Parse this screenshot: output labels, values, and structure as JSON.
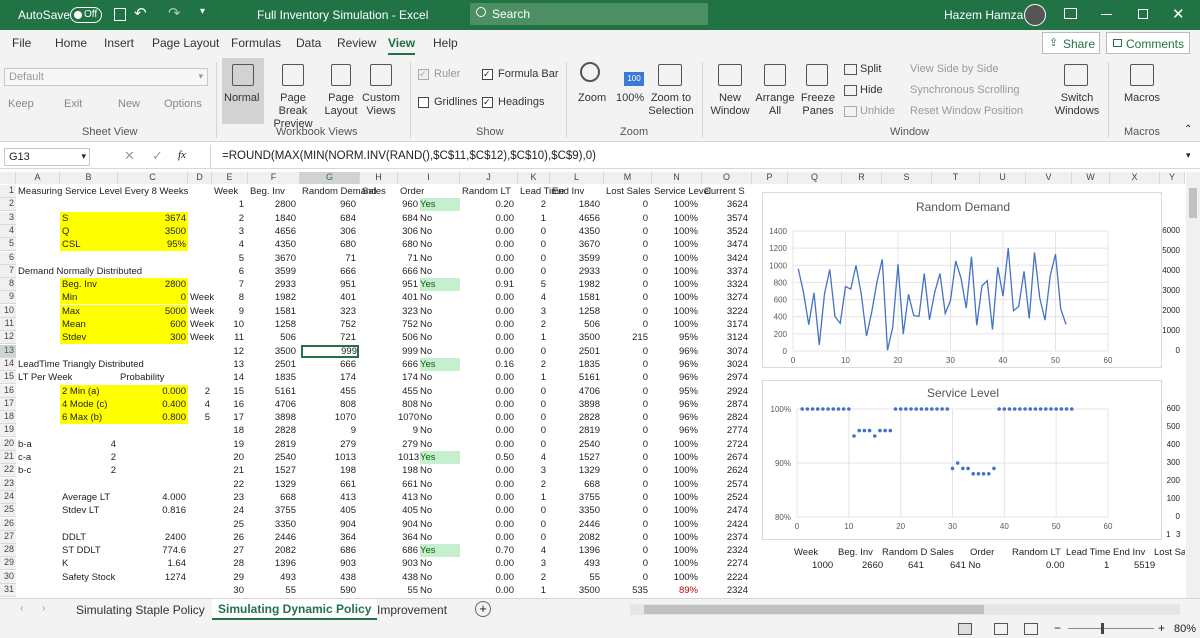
{
  "titlebar": {
    "autosave": "AutoSave",
    "off": "Off",
    "title": "Full Inventory Simulation  -  Excel",
    "search": "Search",
    "user": "Hazem Hamza"
  },
  "menu": [
    "File",
    "Home",
    "Insert",
    "Page Layout",
    "Formulas",
    "Data",
    "Review",
    "View",
    "Help"
  ],
  "share": "Share",
  "comments": "Comments",
  "ribbon": {
    "sheetview_default": "Default",
    "keep": "Keep",
    "exit": "Exit",
    "new": "New",
    "options": "Options",
    "sheet_view": "Sheet View",
    "normal": "Normal",
    "page_break": "Page Break Preview",
    "page_layout": "Page Layout",
    "custom_views": "Custom Views",
    "workbook_views": "Workbook Views",
    "ruler": "Ruler",
    "formula_bar": "Formula Bar",
    "gridlines": "Gridlines",
    "headings": "Headings",
    "show": "Show",
    "zoom": "Zoom",
    "zoom100": "100%",
    "zoom_sel": "Zoom to Selection",
    "zoom_group": "Zoom",
    "zoom_icon_text": "100",
    "new_window": "New Window",
    "arrange_all": "Arrange All",
    "freeze_panes": "Freeze Panes",
    "split": "Split",
    "hide": "Hide",
    "unhide": "Unhide",
    "view_side": "View Side by Side",
    "sync_scroll": "Synchronous Scrolling",
    "reset_pos": "Reset Window Position",
    "window": "Window",
    "switch_windows": "Switch Windows",
    "macros": "Macros",
    "macros_group": "Macros"
  },
  "namebox": "G13",
  "fx": "fx",
  "formula": "=ROUND(MAX(MIN(NORM.INV(RAND(),$C$11,$C$12),$C$10),$C$9),0)",
  "columns": [
    "A",
    "B",
    "C",
    "D",
    "E",
    "F",
    "G",
    "H",
    "I",
    "J",
    "K",
    "L",
    "M",
    "N",
    "O",
    "P",
    "Q",
    "R",
    "S",
    "T",
    "U",
    "V",
    "W",
    "X",
    "Y"
  ],
  "rows": [
    "1",
    "2",
    "3",
    "4",
    "5",
    "6",
    "7",
    "8",
    "9",
    "10",
    "11",
    "12",
    "13",
    "14",
    "15",
    "16",
    "17",
    "18",
    "19",
    "20",
    "21",
    "22",
    "23",
    "24",
    "25",
    "26",
    "27",
    "28",
    "29",
    "30",
    "31"
  ],
  "left": [
    {
      "r": 0,
      "c": "A",
      "t": "Measuring Service Level Every 8 Weeks"
    },
    {
      "r": 2,
      "c": "B",
      "t": "S",
      "y": 1
    },
    {
      "r": 2,
      "c": "C",
      "t": "3674",
      "y": 1,
      "right": 1
    },
    {
      "r": 3,
      "c": "B",
      "t": "Q",
      "y": 1
    },
    {
      "r": 3,
      "c": "C",
      "t": "3500",
      "y": 1,
      "right": 1
    },
    {
      "r": 4,
      "c": "B",
      "t": "CSL",
      "y": 1
    },
    {
      "r": 4,
      "c": "C",
      "t": "95%",
      "y": 1,
      "right": 1
    },
    {
      "r": 6,
      "c": "A",
      "t": "Demand Normally Distributed"
    },
    {
      "r": 7,
      "c": "B",
      "t": "Beg. Inv",
      "y": 1
    },
    {
      "r": 7,
      "c": "C",
      "t": "2800",
      "y": 1,
      "right": 1
    },
    {
      "r": 8,
      "c": "B",
      "t": "Min",
      "y": 1
    },
    {
      "r": 8,
      "c": "C",
      "t": "0",
      "y": 1,
      "right": 1
    },
    {
      "r": 8,
      "c": "D",
      "t": "Week"
    },
    {
      "r": 9,
      "c": "B",
      "t": "Max",
      "y": 1
    },
    {
      "r": 9,
      "c": "C",
      "t": "5000",
      "y": 1,
      "right": 1
    },
    {
      "r": 9,
      "c": "D",
      "t": "Week"
    },
    {
      "r": 10,
      "c": "B",
      "t": "Mean",
      "y": 1
    },
    {
      "r": 10,
      "c": "C",
      "t": "600",
      "y": 1,
      "right": 1
    },
    {
      "r": 10,
      "c": "D",
      "t": "Week"
    },
    {
      "r": 11,
      "c": "B",
      "t": "Stdev",
      "y": 1
    },
    {
      "r": 11,
      "c": "C",
      "t": "300",
      "y": 1,
      "right": 1
    },
    {
      "r": 11,
      "c": "D",
      "t": "Week"
    },
    {
      "r": 13,
      "c": "A",
      "t": "LeadTime Triangly Distributed"
    },
    {
      "r": 14,
      "c": "A",
      "t": "LT Per Week"
    },
    {
      "r": 14,
      "c": "C",
      "t": "Probability"
    },
    {
      "r": 15,
      "c": "B",
      "t": "2 Min (a)",
      "y": 1
    },
    {
      "r": 15,
      "c": "C",
      "t": "0.000",
      "y": 1,
      "right": 1
    },
    {
      "r": 15,
      "c": "D",
      "t": "2",
      "right": 1
    },
    {
      "r": 16,
      "c": "B",
      "t": "4 Mode (c)",
      "y": 1
    },
    {
      "r": 16,
      "c": "C",
      "t": "0.400",
      "y": 1,
      "right": 1
    },
    {
      "r": 16,
      "c": "D",
      "t": "4",
      "right": 1
    },
    {
      "r": 17,
      "c": "B",
      "t": "6 Max (b)",
      "y": 1
    },
    {
      "r": 17,
      "c": "C",
      "t": "0.800",
      "y": 1,
      "right": 1
    },
    {
      "r": 17,
      "c": "D",
      "t": "5",
      "right": 1
    },
    {
      "r": 19,
      "c": "A",
      "t": "b-a"
    },
    {
      "r": 19,
      "c": "B",
      "t": "4",
      "right": 1
    },
    {
      "r": 20,
      "c": "A",
      "t": "c-a"
    },
    {
      "r": 20,
      "c": "B",
      "t": "2",
      "right": 1
    },
    {
      "r": 21,
      "c": "A",
      "t": "b-c"
    },
    {
      "r": 21,
      "c": "B",
      "t": "2",
      "right": 1
    },
    {
      "r": 23,
      "c": "B",
      "t": "Average LT"
    },
    {
      "r": 23,
      "c": "C",
      "t": "4.000",
      "right": 1
    },
    {
      "r": 24,
      "c": "B",
      "t": "Stdev LT"
    },
    {
      "r": 24,
      "c": "C",
      "t": "0.816",
      "right": 1
    },
    {
      "r": 26,
      "c": "B",
      "t": "DDLT"
    },
    {
      "r": 26,
      "c": "C",
      "t": "2400",
      "right": 1
    },
    {
      "r": 27,
      "c": "B",
      "t": "ST DDLT"
    },
    {
      "r": 27,
      "c": "C",
      "t": "774.6",
      "right": 1
    },
    {
      "r": 28,
      "c": "B",
      "t": "K"
    },
    {
      "r": 28,
      "c": "C",
      "t": "1.64",
      "right": 1
    },
    {
      "r": 29,
      "c": "B",
      "t": "Safety Stock"
    },
    {
      "r": 29,
      "c": "C",
      "t": "1274",
      "right": 1
    }
  ],
  "headers": [
    "Week",
    "Beg. Inv",
    "Random Demand",
    "Sales",
    "Order",
    "Random LT",
    "Lead Time",
    "End Inv",
    "Lost Sales",
    "Service Level",
    "Current S"
  ],
  "table": [
    [
      "1",
      "2800",
      "960",
      "960",
      "Yes",
      "0.20",
      "2",
      "1840",
      "0",
      "100%",
      "3624"
    ],
    [
      "2",
      "1840",
      "684",
      "684",
      "No",
      "0.00",
      "1",
      "4656",
      "0",
      "100%",
      "3574"
    ],
    [
      "3",
      "4656",
      "306",
      "306",
      "No",
      "0.00",
      "0",
      "4350",
      "0",
      "100%",
      "3524"
    ],
    [
      "4",
      "4350",
      "680",
      "680",
      "No",
      "0.00",
      "0",
      "3670",
      "0",
      "100%",
      "3474"
    ],
    [
      "5",
      "3670",
      "71",
      "71",
      "No",
      "0.00",
      "0",
      "3599",
      "0",
      "100%",
      "3424"
    ],
    [
      "6",
      "3599",
      "666",
      "666",
      "No",
      "0.00",
      "0",
      "2933",
      "0",
      "100%",
      "3374"
    ],
    [
      "7",
      "2933",
      "951",
      "951",
      "Yes",
      "0.91",
      "5",
      "1982",
      "0",
      "100%",
      "3324"
    ],
    [
      "8",
      "1982",
      "401",
      "401",
      "No",
      "0.00",
      "4",
      "1581",
      "0",
      "100%",
      "3274"
    ],
    [
      "9",
      "1581",
      "323",
      "323",
      "No",
      "0.00",
      "3",
      "1258",
      "0",
      "100%",
      "3224"
    ],
    [
      "10",
      "1258",
      "752",
      "752",
      "No",
      "0.00",
      "2",
      "506",
      "0",
      "100%",
      "3174"
    ],
    [
      "11",
      "506",
      "721",
      "506",
      "No",
      "0.00",
      "1",
      "3500",
      "215",
      "95%",
      "3124"
    ],
    [
      "12",
      "3500",
      "999",
      "999",
      "No",
      "0.00",
      "0",
      "2501",
      "0",
      "96%",
      "3074"
    ],
    [
      "13",
      "2501",
      "666",
      "666",
      "Yes",
      "0.16",
      "2",
      "1835",
      "0",
      "96%",
      "3024"
    ],
    [
      "14",
      "1835",
      "174",
      "174",
      "No",
      "0.00",
      "1",
      "5161",
      "0",
      "96%",
      "2974"
    ],
    [
      "15",
      "5161",
      "455",
      "455",
      "No",
      "0.00",
      "0",
      "4706",
      "0",
      "95%",
      "2924"
    ],
    [
      "16",
      "4706",
      "808",
      "808",
      "No",
      "0.00",
      "0",
      "3898",
      "0",
      "96%",
      "2874"
    ],
    [
      "17",
      "3898",
      "1070",
      "1070",
      "No",
      "0.00",
      "0",
      "2828",
      "0",
      "96%",
      "2824"
    ],
    [
      "18",
      "2828",
      "9",
      "9",
      "No",
      "0.00",
      "0",
      "2819",
      "0",
      "96%",
      "2774"
    ],
    [
      "19",
      "2819",
      "279",
      "279",
      "No",
      "0.00",
      "0",
      "2540",
      "0",
      "100%",
      "2724"
    ],
    [
      "20",
      "2540",
      "1013",
      "1013",
      "Yes",
      "0.50",
      "4",
      "1527",
      "0",
      "100%",
      "2674"
    ],
    [
      "21",
      "1527",
      "198",
      "198",
      "No",
      "0.00",
      "3",
      "1329",
      "0",
      "100%",
      "2624"
    ],
    [
      "22",
      "1329",
      "661",
      "661",
      "No",
      "0.00",
      "2",
      "668",
      "0",
      "100%",
      "2574"
    ],
    [
      "23",
      "668",
      "413",
      "413",
      "No",
      "0.00",
      "1",
      "3755",
      "0",
      "100%",
      "2524"
    ],
    [
      "24",
      "3755",
      "405",
      "405",
      "No",
      "0.00",
      "0",
      "3350",
      "0",
      "100%",
      "2474"
    ],
    [
      "25",
      "3350",
      "904",
      "904",
      "No",
      "0.00",
      "0",
      "2446",
      "0",
      "100%",
      "2424"
    ],
    [
      "26",
      "2446",
      "364",
      "364",
      "No",
      "0.00",
      "0",
      "2082",
      "0",
      "100%",
      "2374"
    ],
    [
      "27",
      "2082",
      "686",
      "686",
      "Yes",
      "0.70",
      "4",
      "1396",
      "0",
      "100%",
      "2324"
    ],
    [
      "28",
      "1396",
      "903",
      "903",
      "No",
      "0.00",
      "3",
      "493",
      "0",
      "100%",
      "2274"
    ],
    [
      "29",
      "493",
      "438",
      "438",
      "No",
      "0.00",
      "2",
      "55",
      "0",
      "100%",
      "2224"
    ],
    [
      "30",
      "55",
      "590",
      "55",
      "No",
      "0.00",
      "1",
      "3500",
      "535",
      "89%",
      "2324"
    ]
  ],
  "right_row": {
    "headers": [
      "Week",
      "Beg. Inv",
      "Random D Sales",
      "Order",
      "Random LT",
      "Lead Time End Inv",
      "Lost Sa"
    ],
    "values": [
      "1000",
      "2660",
      "641",
      "641 No",
      "0.00",
      "1",
      "5519"
    ]
  },
  "chart_data": [
    {
      "type": "line",
      "title": "Random Demand",
      "xlim": [
        0,
        60
      ],
      "ylim": [
        0,
        1400
      ],
      "xticks": [
        0,
        10,
        20,
        30,
        40,
        50,
        60
      ],
      "yticks": [
        0,
        200,
        400,
        600,
        800,
        1000,
        1200,
        1400
      ],
      "values": [
        960,
        684,
        306,
        680,
        71,
        666,
        951,
        401,
        323,
        752,
        721,
        999,
        666,
        174,
        455,
        808,
        1070,
        9,
        279,
        1013,
        198,
        661,
        413,
        405,
        904,
        364,
        686,
        903,
        438,
        590,
        1050,
        850,
        500,
        1100,
        300,
        760,
        820,
        250,
        980,
        640,
        1200,
        470,
        520,
        930,
        380,
        1150,
        620,
        360,
        880,
        1130,
        490,
        310
      ],
      "color": "#4472c4"
    },
    {
      "type": "scatter",
      "title": "Service Level",
      "xlim": [
        0,
        60
      ],
      "ylim": [
        0.8,
        1.0
      ],
      "xticks": [
        0,
        10,
        20,
        30,
        40,
        50,
        60
      ],
      "yticks": [
        "80%",
        "90%",
        "100%"
      ],
      "values": [
        1,
        1,
        1,
        1,
        1,
        1,
        1,
        1,
        1,
        1,
        0.95,
        0.96,
        0.96,
        0.96,
        0.95,
        0.96,
        0.96,
        0.96,
        1,
        1,
        1,
        1,
        1,
        1,
        1,
        1,
        1,
        1,
        1,
        0.89,
        0.9,
        0.89,
        0.89,
        0.88,
        0.88,
        0.88,
        0.88,
        0.89,
        1,
        1,
        1,
        1,
        1,
        1,
        1,
        1,
        1,
        1,
        1,
        1,
        1,
        1,
        1
      ],
      "color": "#4472c4"
    }
  ],
  "side_axis": {
    "left_ticks": [
      "0",
      "1000",
      "2000",
      "3000",
      "4000",
      "5000",
      "6000"
    ],
    "mid_ticks": [
      "0",
      "100",
      "200",
      "300",
      "400",
      "500",
      "600"
    ],
    "bottom": [
      "1",
      "3"
    ]
  },
  "tabs": [
    "Simulating Staple Policy",
    "Simulating Dynamic Policy",
    "Improvement"
  ],
  "status": {
    "zoom": "80%"
  }
}
